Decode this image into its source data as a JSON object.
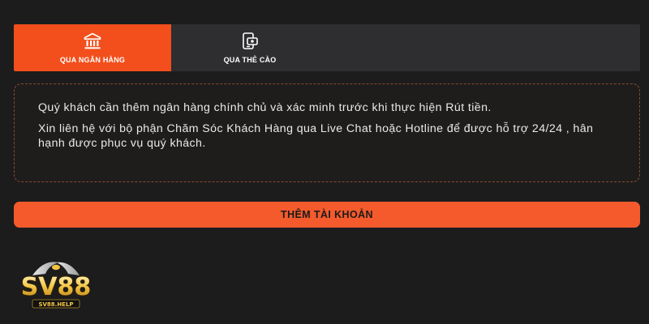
{
  "tabs": [
    {
      "label": "QUA NGÂN HÀNG",
      "icon": "bank-icon",
      "active": true
    },
    {
      "label": "QUA THẺ CÀO",
      "icon": "scratch-card-icon",
      "active": false
    }
  ],
  "notice": {
    "line1": "Quý khách cần thêm ngân hàng chính chủ và xác minh trước khi thực hiện Rút tiền.",
    "line2": "Xin liên hệ với bộ phận Chăm Sóc Khách Hàng qua Live Chat hoặc Hotline để được hỗ trợ 24/24 , hân hạnh được phục vụ quý khách."
  },
  "add_account_button": {
    "label": "THÊM TÀI KHOẢN"
  },
  "logo": {
    "text": "SV88",
    "subtext": "SV88.HELP"
  },
  "colors": {
    "accent": "#f24f1c",
    "button": "#f45a2c",
    "background": "#1c1c1c",
    "tab_bar": "#2e2e30",
    "notice_border": "#8a4a31"
  }
}
